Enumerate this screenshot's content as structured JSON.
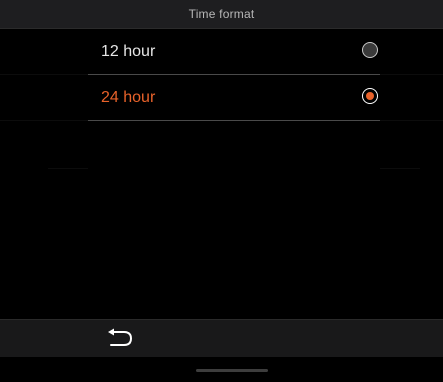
{
  "header": {
    "title": "Time format"
  },
  "options": [
    {
      "label": "12 hour",
      "selected": false
    },
    {
      "label": "24 hour",
      "selected": true
    }
  ],
  "footer": {
    "back_icon": "back-arrow-icon"
  },
  "colors": {
    "accent": "#e8622a",
    "background": "#000000",
    "header_bg": "#1e1e20",
    "footer_bg": "#19191a",
    "text": "#e6e6e6",
    "title_text": "#b7b7b7"
  }
}
